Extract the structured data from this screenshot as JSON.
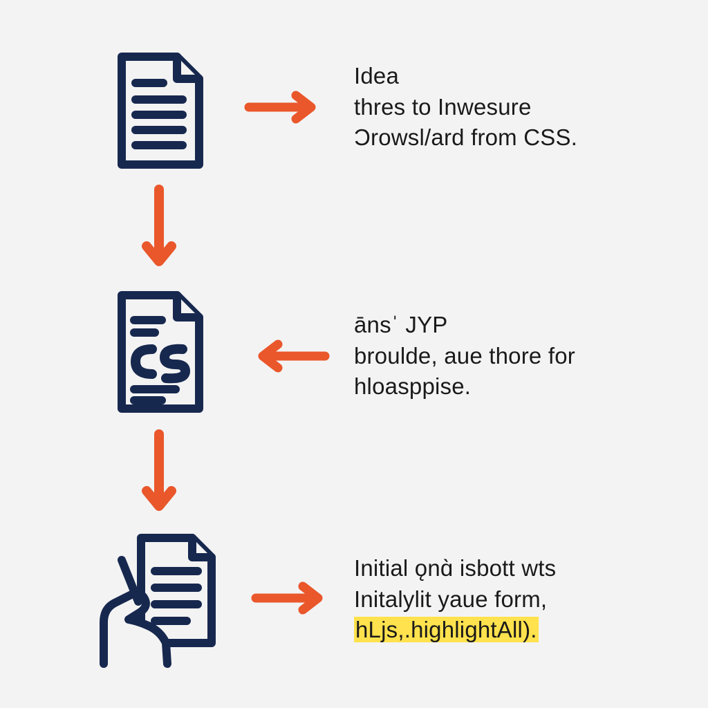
{
  "colors": {
    "navy": "#17284f",
    "orange": "#e9572b",
    "highlight": "#ffe24d",
    "bg": "#f3f3f3"
  },
  "steps": [
    {
      "icon": "document-icon",
      "arrow_to_text": "right",
      "text": {
        "line1": "Idea",
        "line2": "thres to Inwesure",
        "line3": "Ͻrowsl/ard from CSS."
      }
    },
    {
      "icon": "cs-file-icon",
      "arrow_to_text": "left",
      "text": {
        "line1": "ānsˈ JYP",
        "line2": "broulde, aue thore for",
        "line3": "hloasppise."
      }
    },
    {
      "icon": "hand-document-icon",
      "arrow_to_text": "right",
      "text": {
        "line1": "Initial ǫnɑ̀ isbott wts",
        "line2": "Initalylit yaue form,",
        "line3_highlighted": "hLjs,.highlightAll)."
      }
    }
  ],
  "flow_arrows": [
    "down",
    "down"
  ]
}
